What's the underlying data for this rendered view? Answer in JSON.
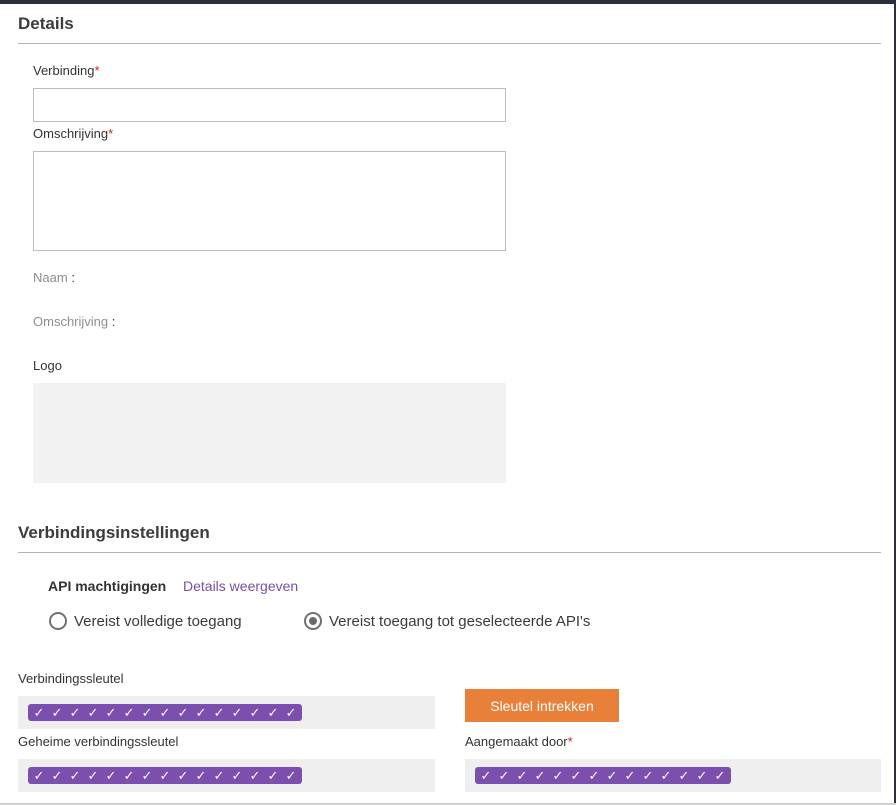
{
  "details": {
    "title": "Details",
    "verbinding_label": "Verbinding",
    "verbinding_value": "",
    "omschrijving_label": "Omschrijving",
    "omschrijving_value": "",
    "required_mark": "*",
    "naam_label": "Naam",
    "omschrijving_static_label": "Omschrijving",
    "colon": ":",
    "logo_label": "Logo"
  },
  "settings": {
    "title": "Verbindingsinstellingen",
    "api_label": "API machtigingen",
    "details_link": "Details weergeven",
    "radio_full": "Vereist volledige toegang",
    "radio_selected": "Vereist toegang tot geselecteerde API's",
    "selected_option": "radio_selected",
    "key_label": "Verbindingssleutel",
    "secret_label": "Geheime verbindingssleutel",
    "created_by_label": "Aangemaakt door",
    "revoke_button": "Sleutel intrekken",
    "mask_glyph": "✓",
    "key_mask_count": 15,
    "secret_mask_count": 15,
    "created_by_mask_count": 14
  },
  "colors": {
    "accent_purple": "#7c4fae",
    "link_purple": "#7b4fa3",
    "button_orange": "#e9803a",
    "required_red": "#cc2222"
  }
}
